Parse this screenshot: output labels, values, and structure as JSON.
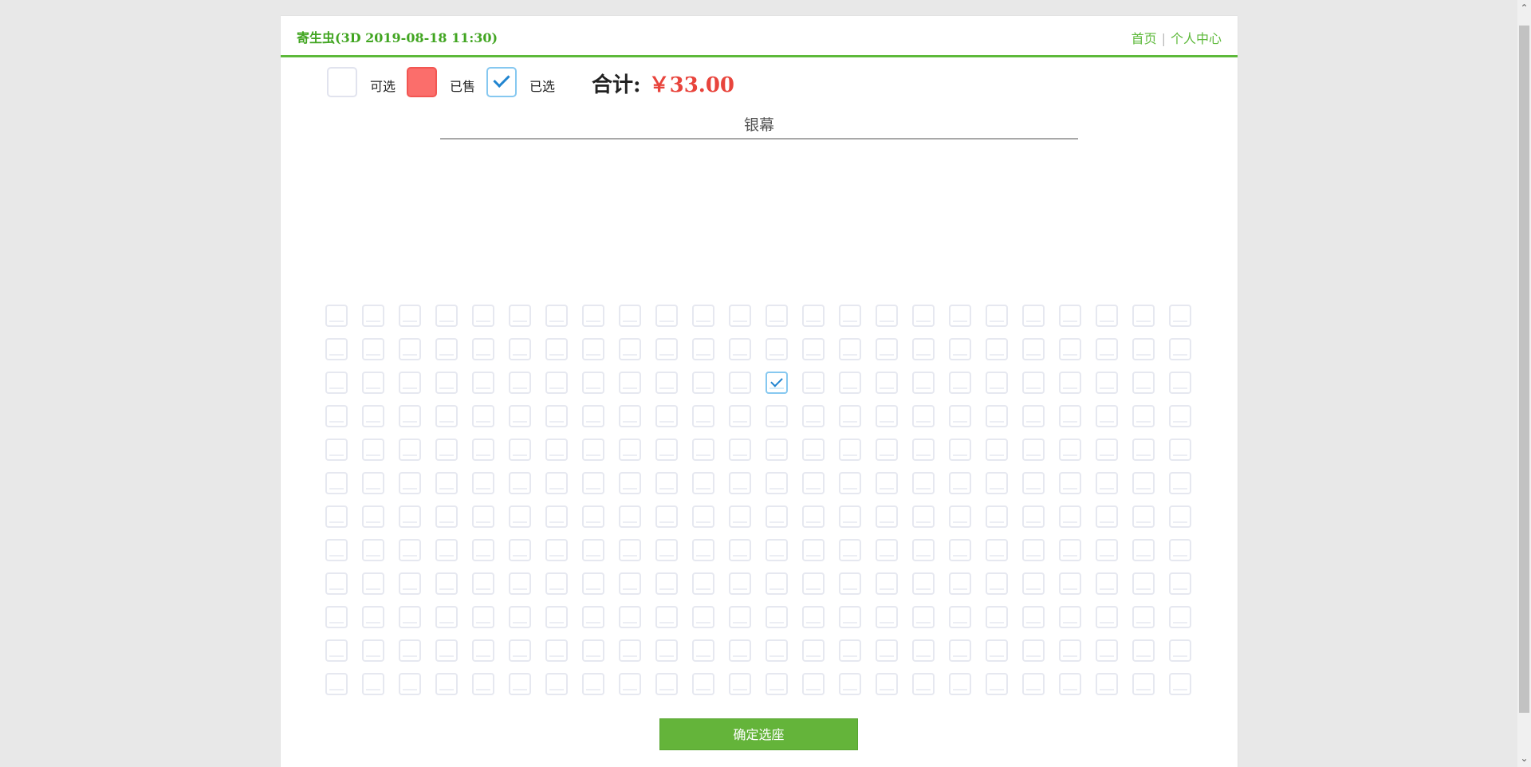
{
  "header": {
    "movie_session": "寄生虫(3D 2019-08-18 11:30)",
    "nav": {
      "home": "首页",
      "separator": "|",
      "profile": "个人中心"
    }
  },
  "legend": {
    "available": "可选",
    "sold": "已售",
    "selected": "已选"
  },
  "summary": {
    "total_label": "合计:",
    "total_price": "￥33.00"
  },
  "screen": {
    "label": "银幕"
  },
  "seat_map": {
    "rows": 12,
    "cols": 24,
    "selected_seats": [
      {
        "row": 3,
        "col": 13
      }
    ],
    "sold_seats": []
  },
  "actions": {
    "confirm_label": "确定选座"
  },
  "colors": {
    "accent_green": "#5db93a",
    "price_red": "#e8443c",
    "sold_red": "#fb6e6b",
    "selected_blue": "#2185d0"
  }
}
